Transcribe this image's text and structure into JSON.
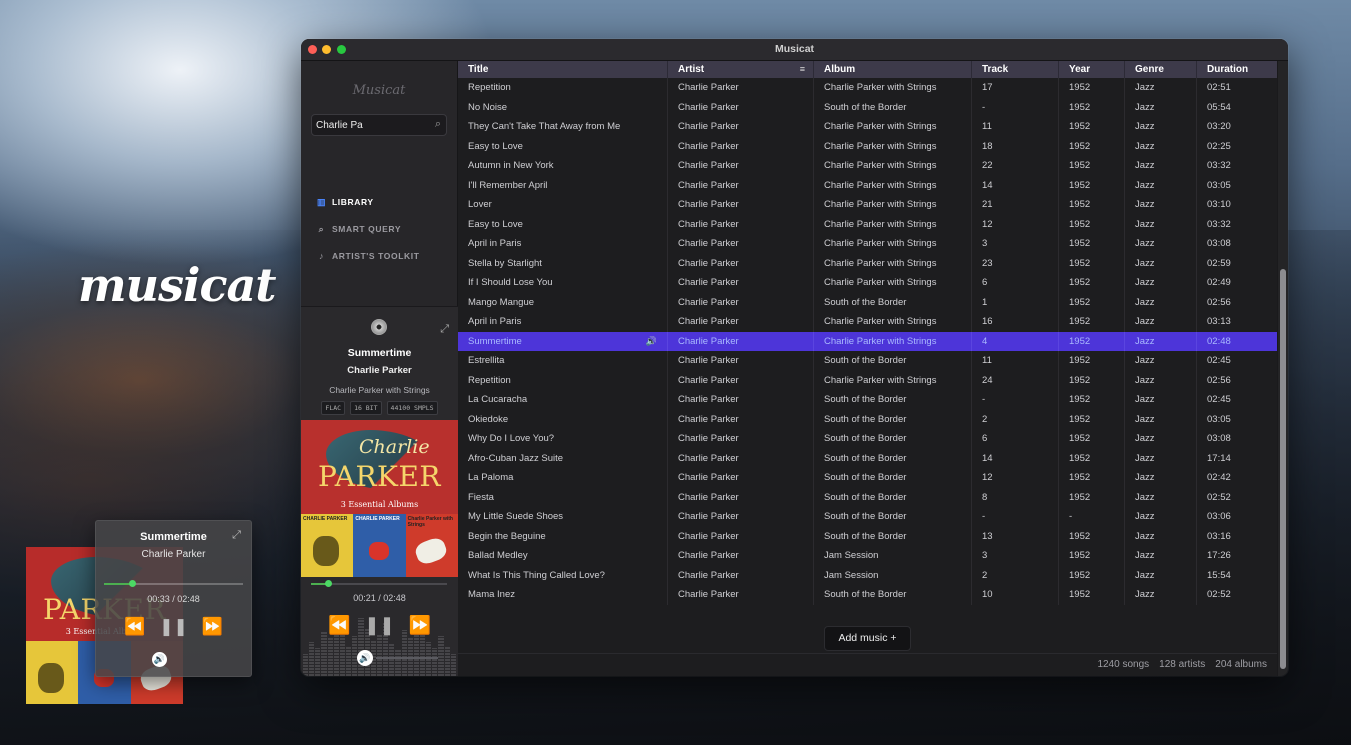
{
  "desktop": {
    "logo_text": "musicat"
  },
  "mini_player": {
    "title": "Summertime",
    "artist": "Charlie Parker",
    "time": "00:33 / 02:48",
    "progress": 0.2
  },
  "window": {
    "title": "Musicat"
  },
  "sidebar": {
    "logo_text": "Musicat",
    "search": {
      "value": "Charlie Pa",
      "placeholder": "Search"
    },
    "nav": [
      {
        "label": "LIBRARY",
        "icon": "library-icon",
        "active": true
      },
      {
        "label": "SMART QUERY",
        "icon": "search-icon",
        "active": false
      },
      {
        "label": "ARTIST'S TOOLKIT",
        "icon": "guitar-icon",
        "active": false
      }
    ]
  },
  "now_playing": {
    "title": "Summertime",
    "artist": "Charlie Parker",
    "album": "Charlie Parker with Strings",
    "badges": [
      "FLAC",
      "16 BIT",
      "44100 SMPLS"
    ],
    "time": "00:21 / 02:48",
    "progress": 0.125,
    "art": {
      "script": "Charlie",
      "name": "PARKER",
      "subtitle": "3 Essential Albums",
      "covers": [
        "CHARLIE PARKER",
        "CHARLIE PARKER",
        "Charlie Parker with Strings"
      ]
    }
  },
  "table": {
    "columns": [
      "Title",
      "Artist",
      "Album",
      "Track",
      "Year",
      "Genre",
      "Duration"
    ],
    "rows": [
      [
        "Repetition",
        "Charlie Parker",
        "Charlie Parker with Strings",
        "17",
        "1952",
        "Jazz",
        "02:51"
      ],
      [
        "No Noise",
        "Charlie Parker",
        "South of the Border",
        "-",
        "1952",
        "Jazz",
        "05:54"
      ],
      [
        "They Can't Take That Away from Me",
        "Charlie Parker",
        "Charlie Parker with Strings",
        "11",
        "1952",
        "Jazz",
        "03:20"
      ],
      [
        "Easy to Love",
        "Charlie Parker",
        "Charlie Parker with Strings",
        "18",
        "1952",
        "Jazz",
        "02:25"
      ],
      [
        "Autumn in New York",
        "Charlie Parker",
        "Charlie Parker with Strings",
        "22",
        "1952",
        "Jazz",
        "03:32"
      ],
      [
        "I'll Remember April",
        "Charlie Parker",
        "Charlie Parker with Strings",
        "14",
        "1952",
        "Jazz",
        "03:05"
      ],
      [
        "Lover",
        "Charlie Parker",
        "Charlie Parker with Strings",
        "21",
        "1952",
        "Jazz",
        "03:10"
      ],
      [
        "Easy to Love",
        "Charlie Parker",
        "Charlie Parker with Strings",
        "12",
        "1952",
        "Jazz",
        "03:32"
      ],
      [
        "April in Paris",
        "Charlie Parker",
        "Charlie Parker with Strings",
        "3",
        "1952",
        "Jazz",
        "03:08"
      ],
      [
        "Stella by Starlight",
        "Charlie Parker",
        "Charlie Parker with Strings",
        "23",
        "1952",
        "Jazz",
        "02:59"
      ],
      [
        "If I Should Lose You",
        "Charlie Parker",
        "Charlie Parker with Strings",
        "6",
        "1952",
        "Jazz",
        "02:49"
      ],
      [
        "Mango Mangue",
        "Charlie Parker",
        "South of the Border",
        "1",
        "1952",
        "Jazz",
        "02:56"
      ],
      [
        "April in Paris",
        "Charlie Parker",
        "Charlie Parker with Strings",
        "16",
        "1952",
        "Jazz",
        "03:13"
      ],
      [
        "Summertime",
        "Charlie Parker",
        "Charlie Parker with Strings",
        "4",
        "1952",
        "Jazz",
        "02:48"
      ],
      [
        "Estrellita",
        "Charlie Parker",
        "South of the Border",
        "11",
        "1952",
        "Jazz",
        "02:45"
      ],
      [
        "Repetition",
        "Charlie Parker",
        "Charlie Parker with Strings",
        "24",
        "1952",
        "Jazz",
        "02:56"
      ],
      [
        "La Cucaracha",
        "Charlie Parker",
        "South of the Border",
        "-",
        "1952",
        "Jazz",
        "02:45"
      ],
      [
        "Okiedoke",
        "Charlie Parker",
        "South of the Border",
        "2",
        "1952",
        "Jazz",
        "03:05"
      ],
      [
        "Why Do I Love You?",
        "Charlie Parker",
        "South of the Border",
        "6",
        "1952",
        "Jazz",
        "03:08"
      ],
      [
        "Afro-Cuban Jazz Suite",
        "Charlie Parker",
        "South of the Border",
        "14",
        "1952",
        "Jazz",
        "17:14"
      ],
      [
        "La Paloma",
        "Charlie Parker",
        "South of the Border",
        "12",
        "1952",
        "Jazz",
        "02:42"
      ],
      [
        "Fiesta",
        "Charlie Parker",
        "South of the Border",
        "8",
        "1952",
        "Jazz",
        "02:52"
      ],
      [
        "My Little Suede Shoes",
        "Charlie Parker",
        "South of the Border",
        "-",
        "-",
        "Jazz",
        "03:06"
      ],
      [
        "Begin the Beguine",
        "Charlie Parker",
        "South of the Border",
        "13",
        "1952",
        "Jazz",
        "03:16"
      ],
      [
        "Ballad Medley",
        "Charlie Parker",
        "Jam Session",
        "3",
        "1952",
        "Jazz",
        "17:26"
      ],
      [
        "What Is This Thing Called Love?",
        "Charlie Parker",
        "Jam Session",
        "2",
        "1952",
        "Jazz",
        "15:54"
      ],
      [
        "Mama Inez",
        "Charlie Parker",
        "South of the Border",
        "10",
        "1952",
        "Jazz",
        "02:52"
      ]
    ],
    "playing_row_index": 13
  },
  "add_music_label": "Add music +",
  "footer": {
    "songs": "1240 songs",
    "artists": "128 artists",
    "albums": "204 albums"
  },
  "colors": {
    "accent": "#4d35d9",
    "progress": "#4cd964",
    "header": "#3d3a4a"
  }
}
